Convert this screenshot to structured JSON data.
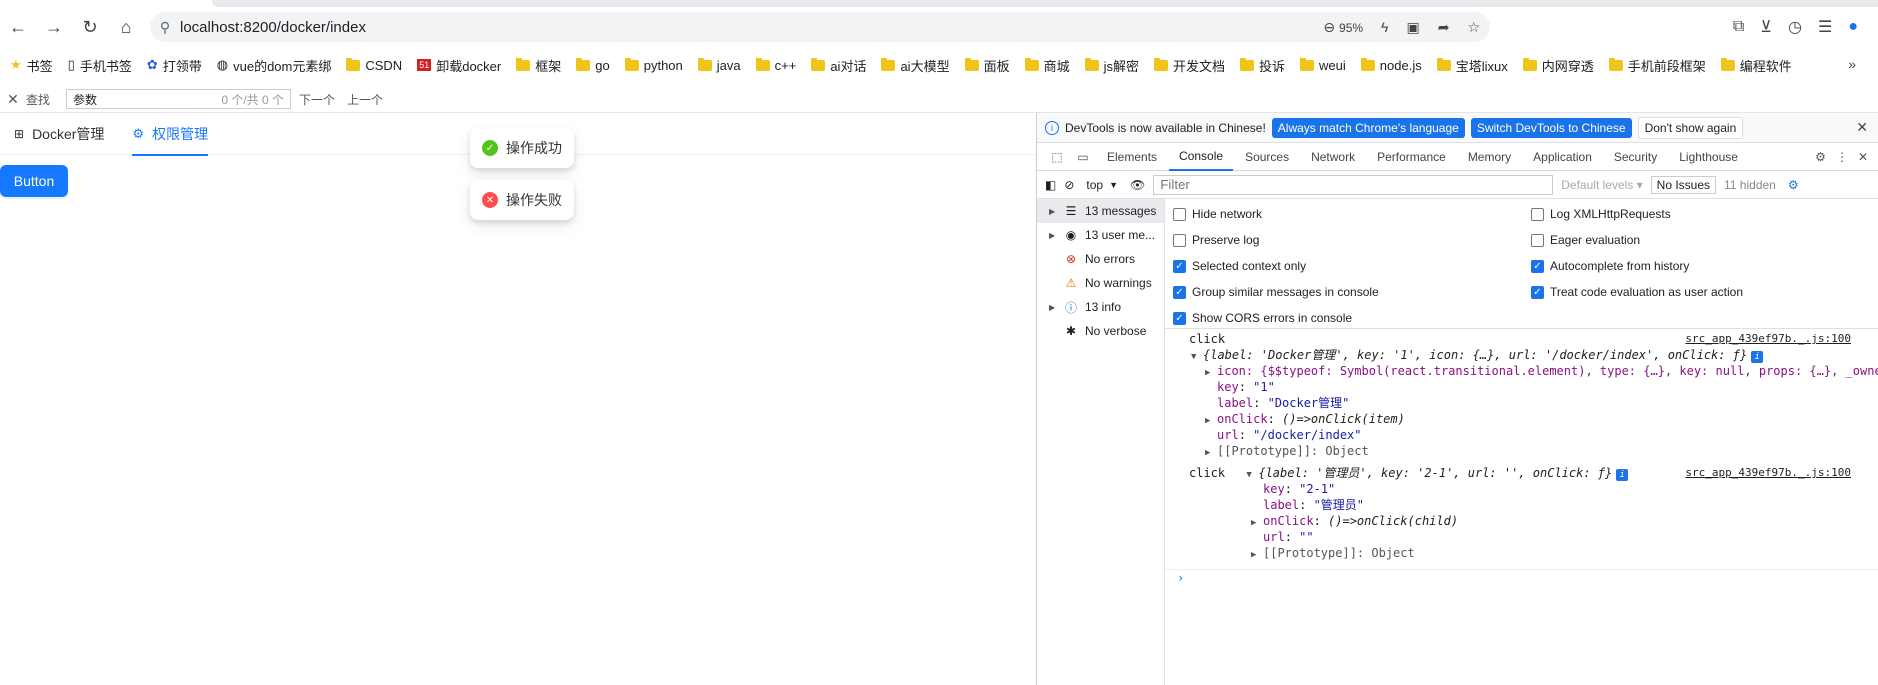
{
  "browser": {
    "url": "localhost:8200/docker/index",
    "zoom": "95%",
    "bookmarks": [
      "书签",
      "手机书签",
      "打领带",
      "vue的dom元素绑",
      "CSDN",
      "卸载docker",
      "框架",
      "go",
      "python",
      "java",
      "c++",
      "ai对话",
      "ai大模型",
      "面板",
      "商城",
      "js解密",
      "开发文档",
      "投诉",
      "weui",
      "node.js",
      "宝塔lixux",
      "内网穿透",
      "手机前段框架",
      "编程软件"
    ]
  },
  "findbar": {
    "label": "查找",
    "value": "参数",
    "count": "0 个/共 0 个",
    "next": "下一个",
    "prev": "上一个"
  },
  "page": {
    "menu": [
      {
        "label": "Docker管理",
        "icon": "appstore-icon"
      },
      {
        "label": "权限管理",
        "icon": "setting-icon"
      }
    ],
    "button_label": "Button",
    "toast_success": "操作成功",
    "toast_error": "操作失败"
  },
  "devtools": {
    "infobar": {
      "text": "DevTools is now available in Chinese!",
      "btn_match": "Always match Chrome's language",
      "btn_switch": "Switch DevTools to Chinese",
      "btn_dont": "Don't show again"
    },
    "tabs": [
      "Elements",
      "Console",
      "Sources",
      "Network",
      "Performance",
      "Memory",
      "Application",
      "Security",
      "Lighthouse"
    ],
    "toolbar": {
      "context": "top",
      "filter_placeholder": "Filter",
      "levels": "Default levels",
      "issues": "No Issues",
      "hidden": "11 hidden"
    },
    "sidebar": [
      {
        "label": "13 messages",
        "icon": "list-icon"
      },
      {
        "label": "13 user me...",
        "icon": "user-icon"
      },
      {
        "label": "No errors",
        "icon": "error-icon"
      },
      {
        "label": "No warnings",
        "icon": "warning-icon"
      },
      {
        "label": "13 info",
        "icon": "info-icon"
      },
      {
        "label": "No verbose",
        "icon": "bug-icon"
      }
    ],
    "settings_left": [
      {
        "label": "Hide network",
        "checked": false
      },
      {
        "label": "Preserve log",
        "checked": false
      },
      {
        "label": "Selected context only",
        "checked": true
      },
      {
        "label": "Group similar messages in console",
        "checked": true
      },
      {
        "label": "Show CORS errors in console",
        "checked": true
      }
    ],
    "settings_right": [
      {
        "label": "Log XMLHttpRequests",
        "checked": false
      },
      {
        "label": "Eager evaluation",
        "checked": false
      },
      {
        "label": "Autocomplete from history",
        "checked": true
      },
      {
        "label": "Treat code evaluation as user action",
        "checked": true
      }
    ],
    "console": {
      "log1_label": "click",
      "source": "src_app_439ef97b._.js:100",
      "obj1_summary": "{label: 'Docker管理', key: '1', icon: {…}, url: '/docker/index', onClick: ƒ}",
      "obj1_icon": "icon: {$$typeof: Symbol(react.transitional.element), type: {…}, key: null, props: {…}, _owner: nu",
      "obj1_key": "\"1\"",
      "obj1_label": "\"Docker管理\"",
      "obj1_onclick": "()=>onClick(item)",
      "obj1_url": "\"/docker/index\"",
      "proto": "[[Prototype]]: Object",
      "log2_label": "click",
      "obj2_summary": "{label: '管理员', key: '2-1', url: '', onClick: ƒ}",
      "obj2_key": "\"2-1\"",
      "obj2_label": "\"管理员\"",
      "obj2_onclick": "()=>onClick(child)",
      "obj2_url": "\"\""
    }
  }
}
